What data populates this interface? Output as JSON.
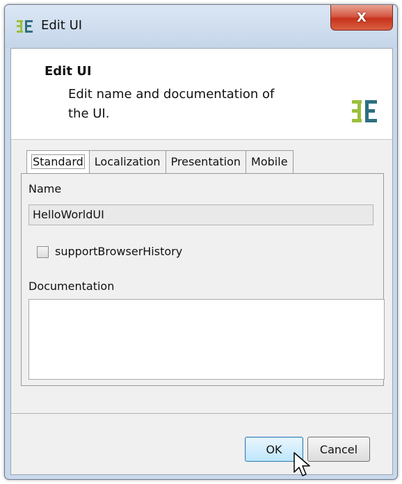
{
  "window": {
    "title": "Edit UI",
    "close_glyph": "X"
  },
  "header": {
    "title": "Edit UI",
    "description": "Edit name and documentation of the UI.",
    "logo_icon": "app-logo-icon"
  },
  "tabs": [
    {
      "label": "Standard",
      "active": true
    },
    {
      "label": "Localization",
      "active": false
    },
    {
      "label": "Presentation",
      "active": false
    },
    {
      "label": "Mobile",
      "active": false
    }
  ],
  "form": {
    "name_label": "Name",
    "name_value": "HelloWorldUI",
    "support_history_label": "supportBrowserHistory",
    "support_history_checked": false,
    "documentation_label": "Documentation",
    "documentation_value": ""
  },
  "buttons": {
    "ok_label": "OK",
    "cancel_label": "Cancel"
  },
  "colors": {
    "logo_green": "#9bbf3b",
    "logo_teal": "#2f6f80",
    "close_red": "#c8321d"
  }
}
